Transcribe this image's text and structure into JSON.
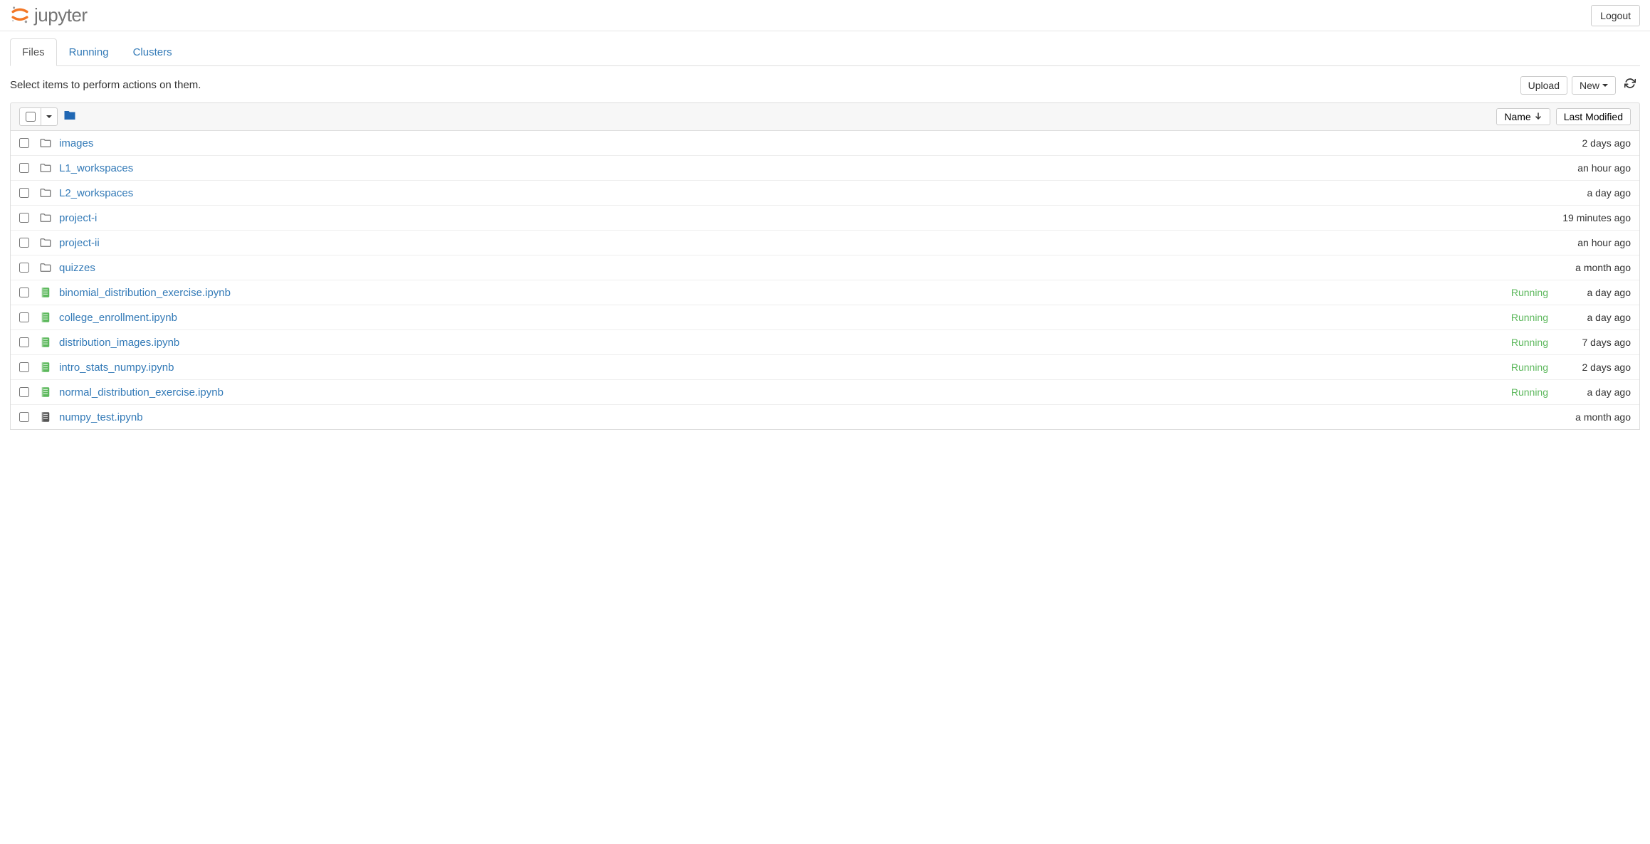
{
  "header": {
    "brand": "jupyter",
    "logout": "Logout"
  },
  "tabs": {
    "files": "Files",
    "running": "Running",
    "clusters": "Clusters"
  },
  "actions": {
    "hint": "Select items to perform actions on them.",
    "upload": "Upload",
    "new": "New"
  },
  "list_header": {
    "name": "Name",
    "last_modified": "Last Modified"
  },
  "items": [
    {
      "type": "folder",
      "name": "images",
      "status": "",
      "modified": "2 days ago"
    },
    {
      "type": "folder",
      "name": "L1_workspaces",
      "status": "",
      "modified": "an hour ago"
    },
    {
      "type": "folder",
      "name": "L2_workspaces",
      "status": "",
      "modified": "a day ago"
    },
    {
      "type": "folder",
      "name": "project-i",
      "status": "",
      "modified": "19 minutes ago"
    },
    {
      "type": "folder",
      "name": "project-ii",
      "status": "",
      "modified": "an hour ago"
    },
    {
      "type": "folder",
      "name": "quizzes",
      "status": "",
      "modified": "a month ago"
    },
    {
      "type": "notebook-running",
      "name": "binomial_distribution_exercise.ipynb",
      "status": "Running",
      "modified": "a day ago"
    },
    {
      "type": "notebook-running",
      "name": "college_enrollment.ipynb",
      "status": "Running",
      "modified": "a day ago"
    },
    {
      "type": "notebook-running",
      "name": "distribution_images.ipynb",
      "status": "Running",
      "modified": "7 days ago"
    },
    {
      "type": "notebook-running",
      "name": "intro_stats_numpy.ipynb",
      "status": "Running",
      "modified": "2 days ago"
    },
    {
      "type": "notebook-running",
      "name": "normal_distribution_exercise.ipynb",
      "status": "Running",
      "modified": "a day ago"
    },
    {
      "type": "notebook",
      "name": "numpy_test.ipynb",
      "status": "",
      "modified": "a month ago"
    }
  ]
}
